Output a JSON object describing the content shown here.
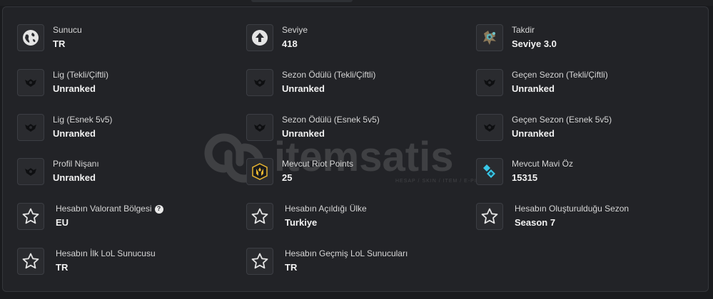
{
  "watermark": {
    "brand": "itemsatis",
    "tagline": "HESAP / SKIN / ITEM / E-PIN .com"
  },
  "fields": {
    "server": {
      "label": "Sunucu",
      "value": "TR",
      "icon": "globe-icon"
    },
    "level": {
      "label": "Seviye",
      "value": "418",
      "icon": "arrow-up-icon"
    },
    "honor": {
      "label": "Takdir",
      "value": "Seviye 3.0",
      "icon": "honor-emblem-icon"
    },
    "league_solo": {
      "label": "Lig (Tekli/Çiftli)",
      "value": "Unranked",
      "icon": "unranked-emblem-icon"
    },
    "season_reward_solo": {
      "label": "Sezon Ödülü (Tekli/Çiftli)",
      "value": "Unranked",
      "icon": "unranked-emblem-icon"
    },
    "last_season_solo": {
      "label": "Geçen Sezon (Tekli/Çiftli)",
      "value": "Unranked",
      "icon": "unranked-emblem-icon"
    },
    "league_flex": {
      "label": "Lig (Esnek 5v5)",
      "value": "Unranked",
      "icon": "unranked-emblem-icon"
    },
    "season_reward_flex": {
      "label": "Sezon Ödülü (Esnek 5v5)",
      "value": "Unranked",
      "icon": "unranked-emblem-icon"
    },
    "last_season_flex": {
      "label": "Geçen Sezon (Esnek 5v5)",
      "value": "Unranked",
      "icon": "unranked-emblem-icon"
    },
    "profile_badge": {
      "label": "Profil Nişanı",
      "value": "Unranked",
      "icon": "unranked-emblem-icon"
    },
    "riot_points": {
      "label": "Mevcut Riot Points",
      "value": "25",
      "icon": "riot-points-icon"
    },
    "blue_essence": {
      "label": "Mevcut Mavi Öz",
      "value": "15315",
      "icon": "blue-essence-icon"
    },
    "valorant_region": {
      "label": "Hesabın Valorant Bölgesi",
      "value": "EU",
      "icon": "star-icon",
      "help": "?"
    },
    "country": {
      "label": "Hesabın Açıldığı Ülke",
      "value": "Turkiye",
      "icon": "star-icon"
    },
    "created_season": {
      "label": "Hesabın Oluşturulduğu Sezon",
      "value": "Season 7",
      "icon": "star-icon"
    },
    "first_server": {
      "label": "Hesabın İlk LoL Sunucusu",
      "value": "TR",
      "icon": "star-icon"
    },
    "past_servers": {
      "label": "Hesabın Geçmiş LoL Sunucuları",
      "value": "TR",
      "icon": "star-icon"
    }
  },
  "colors": {
    "background": "#1a1b1e",
    "panel": "#222327",
    "border": "#34363b",
    "text": "#f2f2f2",
    "riot_points": "#e8b530",
    "blue_essence": "#38c6e6"
  }
}
